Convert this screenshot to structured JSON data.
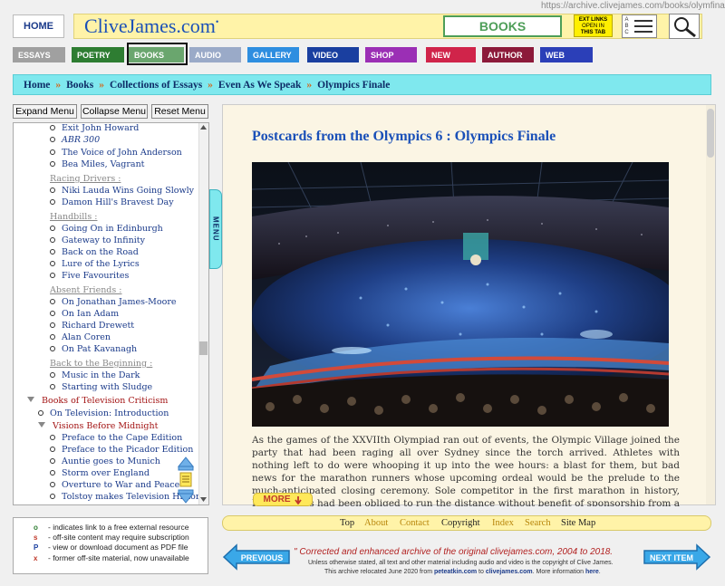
{
  "url": "https://archive.clivejames.com/books/olymfinale.htm",
  "header": {
    "home": "HOME",
    "site_title": "CliveJames.com",
    "site_title_mark": "•",
    "section": "BOOKS",
    "ext_links": [
      "EXT LINKS",
      "OPEN IN",
      "THIS TAB"
    ],
    "abc": [
      "A",
      "B",
      "C"
    ]
  },
  "nav": [
    {
      "label": "ESSAYS",
      "color": "#a0a0a0"
    },
    {
      "label": "POETRY",
      "color": "#2e7d32"
    },
    {
      "label": "BOOKS",
      "color": "#6aa66e"
    },
    {
      "label": "AUDIO",
      "color": "#9aaac8"
    },
    {
      "label": "GALLERY",
      "color": "#2e8ee0"
    },
    {
      "label": "VIDEO",
      "color": "#1a3fa0"
    },
    {
      "label": "SHOP",
      "color": "#9b2fb5"
    },
    {
      "label": "NEW",
      "color": "#d0244a"
    },
    {
      "label": "AUTHOR",
      "color": "#8c1a3a"
    },
    {
      "label": "WEB",
      "color": "#2b3fb8"
    }
  ],
  "breadcrumb": [
    "Home",
    "Books",
    "Collections of Essays",
    "Even As We Speak",
    "Olympics Finale"
  ],
  "breadcrumb_sep": "»",
  "menu_buttons": [
    "Expand Menu",
    "Collapse Menu",
    "Reset Menu"
  ],
  "menu_tab": "MENU",
  "menu_items": [
    {
      "t": "Exit John Howard",
      "k": "item"
    },
    {
      "t": "ABR 300",
      "k": "item",
      "italic": true
    },
    {
      "t": "The Voice of John Anderson",
      "k": "item"
    },
    {
      "t": "Bea Miles, Vagrant",
      "k": "item"
    },
    {
      "t": "Racing Drivers :",
      "k": "grp"
    },
    {
      "t": "Niki Lauda Wins Going Slowly",
      "k": "item"
    },
    {
      "t": "Damon Hill's Bravest Day",
      "k": "item"
    },
    {
      "t": "Handbills :",
      "k": "grp"
    },
    {
      "t": "Going On in Edinburgh",
      "k": "item"
    },
    {
      "t": "Gateway to Infinity",
      "k": "item"
    },
    {
      "t": "Back on the Road",
      "k": "item"
    },
    {
      "t": "Lure of the Lyrics",
      "k": "item"
    },
    {
      "t": "Five Favourites",
      "k": "item"
    },
    {
      "t": "Absent Friends :",
      "k": "grp"
    },
    {
      "t": "On Jonathan James-Moore",
      "k": "item"
    },
    {
      "t": "On Ian Adam",
      "k": "item"
    },
    {
      "t": "Richard Drewett",
      "k": "item"
    },
    {
      "t": "Alan Coren",
      "k": "item"
    },
    {
      "t": "On Pat Kavanagh",
      "k": "item"
    },
    {
      "t": "Back to the Beginning :",
      "k": "grp"
    },
    {
      "t": "Music in the Dark",
      "k": "item"
    },
    {
      "t": "Starting with Sludge",
      "k": "item"
    },
    {
      "t": "Books of Television Criticism",
      "k": "sect"
    },
    {
      "t": "On Television: Introduction",
      "k": "sub"
    },
    {
      "t": "Visions Before Midnight",
      "k": "subopen"
    },
    {
      "t": "Preface to the Cape Edition",
      "k": "item2"
    },
    {
      "t": "Preface to the Picador Edition",
      "k": "item2"
    },
    {
      "t": "Auntie goes to Munich",
      "k": "item2"
    },
    {
      "t": "Storm over England",
      "k": "item2"
    },
    {
      "t": "Overture to War and Peace",
      "k": "item2"
    },
    {
      "t": "Tolstoy makes Television History",
      "k": "item2"
    }
  ],
  "legend": [
    {
      "key": "o",
      "color": "#2e7d32",
      "text": "- indicates link to a free external resource"
    },
    {
      "key": "s",
      "color": "#c0392b",
      "text": "- off-site content may require subscription"
    },
    {
      "key": "P",
      "color": "#1a3fa0",
      "text": "- view or download document as PDF file"
    },
    {
      "key": "x",
      "color": "#c0392b",
      "text": "- former off-site material, now unavailable"
    }
  ],
  "article": {
    "title": "Postcards from the Olympics 6 : Olympics Finale",
    "body": "As the games of the XXVIIth Olympiad ran out of events, the Olympic Village joined the party that had been raging all over Sydney since the torch arrived. Athletes with nothing left to do were whooping it up into the wee hours: a blast for them, but bad news for the marathon runners whose upcoming ordeal would be the prelude to the much-anticipated closing ceremony. Sole competitor in the first marathon in history, Pheidippides had been obliged to run the distance without benefit of sponsorship from a shoe manufacturer, but at least he got some kip the night before.",
    "more": "MORE"
  },
  "footer_links": [
    "Top",
    "About",
    "Contact",
    "Copyright",
    "Index",
    "Search",
    "Site Map"
  ],
  "prev": "PREVIOUS",
  "next": "NEXT ITEM",
  "archive_note": "\" Corrected and enhanced archive of the original clivejames.com, 2004 to 2018.",
  "copyright_line": "Unless otherwise stated, all text and other material including audio and video is the copyright of Clive James.",
  "relocation": {
    "pre": "This archive relocated June 2020 from ",
    "from": "peteatkin.com",
    "mid": " to ",
    "to": "clivejames.com",
    "post": ". More information ",
    "here": "here",
    "end": "."
  }
}
